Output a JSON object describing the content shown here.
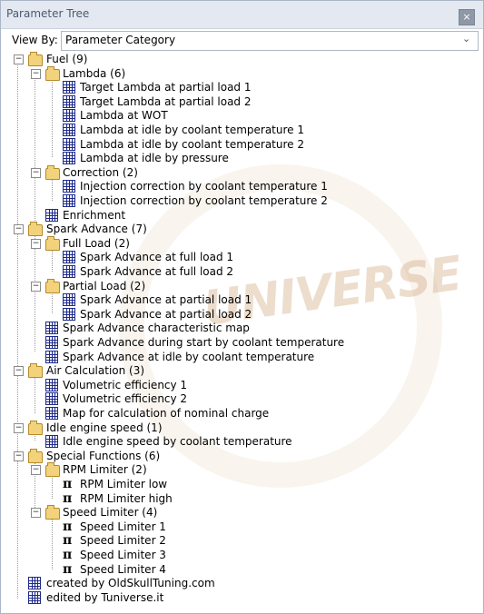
{
  "window": {
    "title": "Parameter Tree",
    "close_glyph": "×"
  },
  "view_by": {
    "label": "View By:",
    "selected": "Parameter Category"
  },
  "watermark": {
    "text": "UNIVERSE"
  },
  "tree": [
    {
      "label": "Fuel (9)"
    },
    {
      "label": "Lambda (6)"
    },
    {
      "label": "Target Lambda at partial load 1"
    },
    {
      "label": "Target Lambda at partial load 2"
    },
    {
      "label": "Lambda at WOT"
    },
    {
      "label": "Lambda at idle by coolant temperature 1"
    },
    {
      "label": "Lambda at idle by coolant temperature 2"
    },
    {
      "label": "Lambda at idle by pressure"
    },
    {
      "label": "Correction (2)"
    },
    {
      "label": "Injection correction by coolant temperature 1"
    },
    {
      "label": "Injection correction by coolant temperature 2"
    },
    {
      "label": "Enrichment"
    },
    {
      "label": "Spark Advance (7)"
    },
    {
      "label": "Full Load (2)"
    },
    {
      "label": "Spark Advance at full load 1"
    },
    {
      "label": "Spark Advance at full load 2"
    },
    {
      "label": "Partial Load (2)"
    },
    {
      "label": "Spark Advance at partial load 1"
    },
    {
      "label": "Spark Advance at partial load 2"
    },
    {
      "label": "Spark Advance characteristic map"
    },
    {
      "label": "Spark Advance during start by coolant temperature"
    },
    {
      "label": "Spark Advance at idle by coolant temperature"
    },
    {
      "label": "Air Calculation (3)"
    },
    {
      "label": "Volumetric efficiency 1"
    },
    {
      "label": "Volumetric efficiency 2"
    },
    {
      "label": "Map for calculation of nominal charge"
    },
    {
      "label": "Idle engine speed (1)"
    },
    {
      "label": "Idle engine speed by coolant temperature"
    },
    {
      "label": "Special Functions (6)"
    },
    {
      "label": "RPM Limiter (2)"
    },
    {
      "label": "RPM Limiter low"
    },
    {
      "label": "RPM Limiter high"
    },
    {
      "label": "Speed Limiter (4)"
    },
    {
      "label": "Speed Limiter 1"
    },
    {
      "label": "Speed Limiter 2"
    },
    {
      "label": "Speed Limiter 3"
    },
    {
      "label": "Speed Limiter 4"
    },
    {
      "label": "created by OldSkullTuning.com"
    },
    {
      "label": "edited by Tuniverse.it"
    }
  ],
  "icons": {
    "folder": "folder-open-icon",
    "table": "table-map-icon",
    "scalar": "pi-constant-icon"
  },
  "glyphs": {
    "pi": "π",
    "minus": "−",
    "chevron": "⌄"
  }
}
